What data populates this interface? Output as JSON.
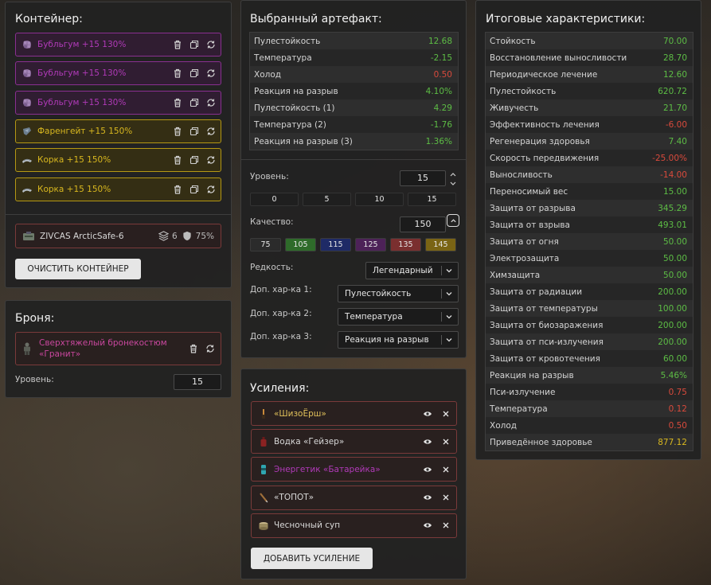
{
  "container": {
    "title": "Контейнер:",
    "items": [
      {
        "label": "Бубльгум +15 130%",
        "icon": "bubblegum-artifact-icon"
      },
      {
        "label": "Бубльгум +15 130%",
        "icon": "bubblegum-artifact-icon"
      },
      {
        "label": "Бубльгум +15 130%",
        "icon": "bubblegum-artifact-icon"
      },
      {
        "label": "Фаренгейт +15 150%",
        "icon": "fahrenheit-artifact-icon"
      },
      {
        "label": "Корка +15 150%",
        "icon": "crust-artifact-icon"
      },
      {
        "label": "Корка +15 150%",
        "icon": "crust-artifact-icon"
      }
    ],
    "case": {
      "label": "ZIVCAS ArcticSafe-6",
      "slots": "6",
      "protection": "75%"
    },
    "clear_button": "ОЧИСТИТЬ КОНТЕЙНЕР"
  },
  "armor": {
    "title": "Броня:",
    "item_label": "Сверхтяжелый бронекостюм «Гранит»",
    "level_label": "Уровень:",
    "level_value": "15"
  },
  "artifact": {
    "title": "Выбранный артефакт:",
    "stats": [
      {
        "name": "Пулестойкость",
        "value": "12.68",
        "color": "green"
      },
      {
        "name": "Температура",
        "value": "-2.15",
        "color": "green"
      },
      {
        "name": "Холод",
        "value": "0.50",
        "color": "red"
      },
      {
        "name": "Реакция на разрыв",
        "value": "4.10%",
        "color": "green"
      },
      {
        "name": "Пулестойкость (1)",
        "value": "4.29",
        "color": "green"
      },
      {
        "name": "Температура (2)",
        "value": "-1.76",
        "color": "green"
      },
      {
        "name": "Реакция на разрыв (3)",
        "value": "1.36%",
        "color": "green"
      }
    ],
    "level_label": "Уровень:",
    "level_value": "15",
    "level_presets": [
      "0",
      "5",
      "10",
      "15"
    ],
    "quality_label": "Качество:",
    "quality_value": "150",
    "quality_presets": [
      {
        "label": "75",
        "color": "#2b2b2b"
      },
      {
        "label": "105",
        "color": "#2e6b2a"
      },
      {
        "label": "115",
        "color": "#1e2a66"
      },
      {
        "label": "125",
        "color": "#4d2258"
      },
      {
        "label": "135",
        "color": "#7a2f2f"
      },
      {
        "label": "145",
        "color": "#7a6414"
      }
    ],
    "rarity_label": "Редкость:",
    "rarity_value": "Легендарный",
    "extra1_label": "Доп. хар-ка 1:",
    "extra1_value": "Пулестойкость",
    "extra2_label": "Доп. хар-ка 2:",
    "extra2_value": "Температура",
    "extra3_label": "Доп. хар-ка 3:",
    "extra3_value": "Реакция на разрыв"
  },
  "boosts": {
    "title": "Усиления:",
    "items": [
      {
        "label": "«ШизоЁрш»",
        "color": "#e0c05a",
        "icon": "brush-icon"
      },
      {
        "label": "Водка «Гейзер»",
        "color": "#d8d8d8",
        "icon": "bottle-icon"
      },
      {
        "label": "Энергетик «Батарейка»",
        "color": "#b13ab9",
        "icon": "energy-drink-icon"
      },
      {
        "label": "«ТОПОТ»",
        "color": "#d8d8d8",
        "icon": "syringe-icon"
      },
      {
        "label": "Чесночный суп",
        "color": "#d8d8d8",
        "icon": "soup-can-icon"
      }
    ],
    "add_button": "ДОБАВИТЬ УСИЛЕНИЕ"
  },
  "totals": {
    "title": "Итоговые характеристики:",
    "stats": [
      {
        "name": "Стойкость",
        "value": "70.00",
        "color": "green"
      },
      {
        "name": "Восстановление выносливости",
        "value": "28.70",
        "color": "green"
      },
      {
        "name": "Периодическое лечение",
        "value": "12.60",
        "color": "green"
      },
      {
        "name": "Пулестойкость",
        "value": "620.72",
        "color": "green"
      },
      {
        "name": "Живучесть",
        "value": "21.70",
        "color": "green"
      },
      {
        "name": "Эффективность лечения",
        "value": "-6.00",
        "color": "red"
      },
      {
        "name": "Регенерация здоровья",
        "value": "7.40",
        "color": "green"
      },
      {
        "name": "Скорость передвижения",
        "value": "-25.00%",
        "color": "red"
      },
      {
        "name": "Выносливость",
        "value": "-14.00",
        "color": "red"
      },
      {
        "name": "Переносимый вес",
        "value": "15.00",
        "color": "green"
      },
      {
        "name": "Защита от разрыва",
        "value": "345.29",
        "color": "green"
      },
      {
        "name": "Защита от взрыва",
        "value": "493.01",
        "color": "green"
      },
      {
        "name": "Защита от огня",
        "value": "50.00",
        "color": "green"
      },
      {
        "name": "Электрозащита",
        "value": "50.00",
        "color": "green"
      },
      {
        "name": "Химзащита",
        "value": "50.00",
        "color": "green"
      },
      {
        "name": "Защита от радиации",
        "value": "200.00",
        "color": "green"
      },
      {
        "name": "Защита от температуры",
        "value": "100.00",
        "color": "green"
      },
      {
        "name": "Защита от биозаражения",
        "value": "200.00",
        "color": "green"
      },
      {
        "name": "Защита от пси-излучения",
        "value": "200.00",
        "color": "green"
      },
      {
        "name": "Защита от кровотечения",
        "value": "60.00",
        "color": "green"
      },
      {
        "name": "Реакция на разрыв",
        "value": "5.46%",
        "color": "green"
      },
      {
        "name": "Пси-излучение",
        "value": "0.75",
        "color": "red"
      },
      {
        "name": "Температура",
        "value": "0.12",
        "color": "red"
      },
      {
        "name": "Холод",
        "value": "0.50",
        "color": "red"
      },
      {
        "name": "Приведённое здоровье",
        "value": "877.12",
        "color": "yellow"
      }
    ]
  }
}
